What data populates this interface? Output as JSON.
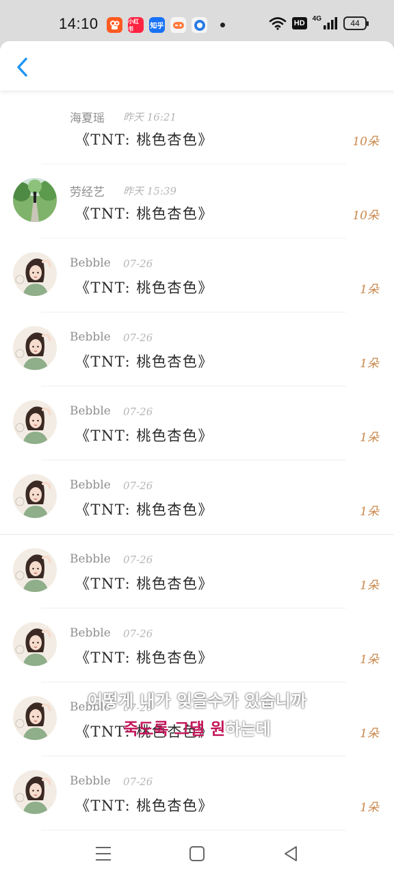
{
  "status_bar": {
    "time": "14:10",
    "apps": [
      {
        "name": "kuaishou-icon",
        "label": "",
        "color": "#ff5a1f"
      },
      {
        "name": "xiaohongshu-icon",
        "label": "小红书",
        "color": "#ff2442"
      },
      {
        "name": "zhihu-icon",
        "label": "知乎",
        "color": "#1772f6"
      },
      {
        "name": "game-icon",
        "label": "",
        "color": "#f0f0f0"
      },
      {
        "name": "app-circle-icon",
        "label": "",
        "color": "#2b7be4"
      }
    ],
    "hd_label": "HD",
    "network_label": "4G",
    "battery_level": "44"
  },
  "colors": {
    "accent_blue": "#2196f3",
    "amount_orange": "#c9874a"
  },
  "list": {
    "items": [
      {
        "name": "海夏瑶",
        "time": "昨天 16:21",
        "title": "《TNT: 桃色杏色》",
        "amount": "10朵",
        "avatar": "none"
      },
      {
        "name": "劳经艺",
        "time": "昨天 15:39",
        "title": "《TNT: 桃色杏色》",
        "amount": "10朵",
        "avatar": "park"
      },
      {
        "name": "Bebble",
        "time": "07-26",
        "title": "《TNT: 桃色杏色》",
        "amount": "1朵",
        "avatar": "girl"
      },
      {
        "name": "Bebble",
        "time": "07-26",
        "title": "《TNT: 桃色杏色》",
        "amount": "1朵",
        "avatar": "girl"
      },
      {
        "name": "Bebble",
        "time": "07-26",
        "title": "《TNT: 桃色杏色》",
        "amount": "1朵",
        "avatar": "girl"
      },
      {
        "name": "Bebble",
        "time": "07-26",
        "title": "《TNT: 桃色杏色》",
        "amount": "1朵",
        "avatar": "girl"
      },
      {
        "name": "Bebble",
        "time": "07-26",
        "title": "《TNT: 桃色杏色》",
        "amount": "1朵",
        "avatar": "girl"
      },
      {
        "name": "Bebble",
        "time": "07-26",
        "title": "《TNT: 桃色杏色》",
        "amount": "1朵",
        "avatar": "girl"
      },
      {
        "name": "Bebble",
        "time": "07-26",
        "title": "《TNT: 桃色杏色》",
        "amount": "1朵",
        "avatar": "girl"
      },
      {
        "name": "Bebble",
        "time": "07-26",
        "title": "《TNT: 桃色杏色》",
        "amount": "1朵",
        "avatar": "girl"
      }
    ]
  },
  "subtitle": {
    "line1": "어떻게 내가 잊을수가 있습니까",
    "line2_highlight": "죽도록 그댈 원",
    "line2_rest": "하는데"
  },
  "nav": {
    "buttons": [
      "menu-icon",
      "home-square-icon",
      "back-triangle-icon"
    ]
  }
}
